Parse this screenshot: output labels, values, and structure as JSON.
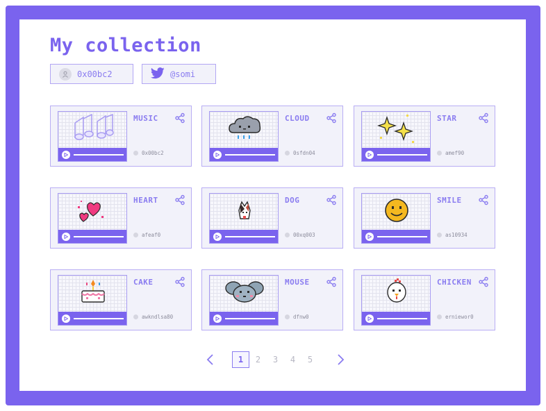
{
  "page": {
    "title": "My collection",
    "accent": "#7a63ee"
  },
  "profile": {
    "wallet": "0x00bc2",
    "twitter": "@somi",
    "wallet_icon": "user-icon",
    "twitter_icon": "twitter-bird-icon"
  },
  "cards": [
    {
      "name": "MUSIC",
      "owner": "0x00bc2",
      "art": "music-notes"
    },
    {
      "name": "CLOUD",
      "owner": "0sfdn04",
      "art": "rain-cloud"
    },
    {
      "name": "STAR",
      "owner": "amef90",
      "art": "sparkle-stars"
    },
    {
      "name": "HEART",
      "owner": "afeaf0",
      "art": "hearts"
    },
    {
      "name": "DOG",
      "owner": "00xq003",
      "art": "dog"
    },
    {
      "name": "SMILE",
      "owner": "as10934",
      "art": "smiley"
    },
    {
      "name": "CAKE",
      "owner": "awkndlsa80",
      "art": "birthday-cake"
    },
    {
      "name": "MOUSE",
      "owner": "dfnw0",
      "art": "mouse"
    },
    {
      "name": "CHICKEN",
      "owner": "erniewor0",
      "art": "chicken"
    }
  ],
  "pagination": {
    "pages": [
      "1",
      "2",
      "3",
      "4",
      "5"
    ],
    "current": "1"
  }
}
